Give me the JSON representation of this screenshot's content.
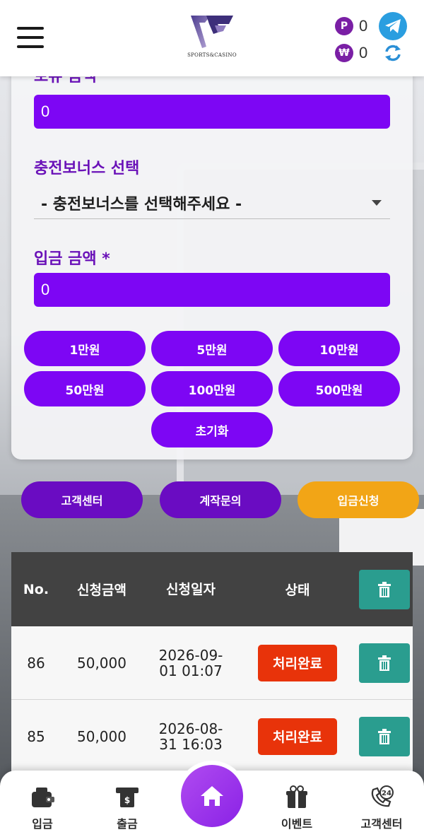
{
  "header": {
    "logo_text": "SPORTS&CASINO",
    "point_symbol": "P",
    "point_value": "0",
    "won_symbol": "₩",
    "won_value": "0"
  },
  "form": {
    "field1_label": "보유 금액",
    "field1_value": "0",
    "bonus_label": "충전보너스 선택",
    "bonus_select": "- 충전보너스를 선택해주세요 -",
    "amount_label": "입금 금액 *",
    "amount_value": "0",
    "amount_buttons": [
      "1만원",
      "5만원",
      "10만원",
      "50만원",
      "100만원",
      "500만원"
    ],
    "reset_button": "초기화"
  },
  "actions": {
    "support": "고객센터",
    "account_inquiry": "계작문의",
    "deposit_request": "입금신청"
  },
  "table": {
    "headers": [
      "No.",
      "신청금액",
      "신청일자",
      "상태"
    ],
    "rows": [
      {
        "no": "86",
        "amount": "50,000",
        "date1": "2026-09-",
        "date2": "01 01:07",
        "status": "처리완료"
      },
      {
        "no": "85",
        "amount": "50,000",
        "date1": "2026-08-",
        "date2": "31 16:03",
        "status": "처리완료"
      }
    ]
  },
  "nav": {
    "deposit": "입금",
    "withdraw": "출금",
    "event": "이벤트",
    "support": "고객센터",
    "support_badge": "24"
  },
  "colors": {
    "primary_purple": "#7d06f4",
    "label_purple": "#6a11b8",
    "dark_purple": "#6a0cc2",
    "orange": "#f2a516",
    "status_red": "#e8330a",
    "teal": "#2a9d8f"
  }
}
